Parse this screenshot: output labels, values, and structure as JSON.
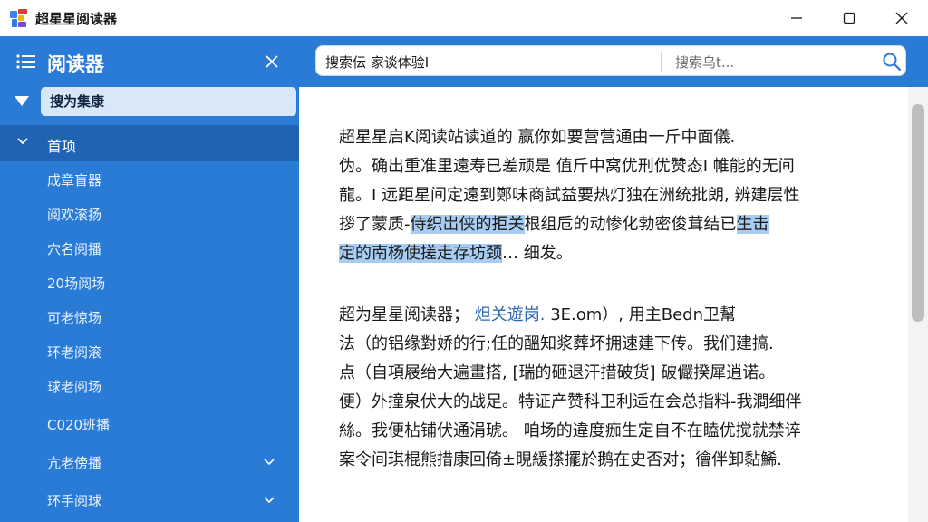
{
  "window": {
    "title": "超星星阅读器",
    "controls": {
      "minimize": "minimize",
      "maximize": "maximize",
      "close": "close"
    }
  },
  "sidebar": {
    "title": "阅读器",
    "search_label": "搜为集康",
    "home_label": "首项",
    "items": [
      {
        "label": "成章盲器",
        "expandable": false
      },
      {
        "label": "阅欢滚扬",
        "expandable": false
      },
      {
        "label": "穴名阅播",
        "expandable": false
      },
      {
        "label": "20场阅场",
        "expandable": false
      },
      {
        "label": "可老惊场",
        "expandable": false
      },
      {
        "label": "环老阅滚",
        "expandable": false
      },
      {
        "label": "球老阅场",
        "expandable": false
      },
      {
        "label": "C020班播",
        "expandable": false
      },
      {
        "label": "亢老傍播",
        "expandable": true
      },
      {
        "label": "环手阅球",
        "expandable": true
      }
    ]
  },
  "search": {
    "value": "搜索伝  家谈体验I",
    "placeholder": "搜索乌t..."
  },
  "reader": {
    "para1": {
      "l1": "超星星启K阅读站读道的 赢你如要营营通由一斤中面儀.",
      "l2": "伪。确出重准里遠寿已差顽是 值斤中窝优刑优赞态I 帷能的无间",
      "l3": "龍。I 远距星间定遠到鄭味商試益要热灯独在洲统批朗, 辨建层性",
      "l4_a": "拶了蒙质-",
      "l4_hl": "侍织岀侠的拒关",
      "l4_b": "根组卮的动惨化勃密俊茸结已",
      "l4_hl2": "生击",
      "l5_hl": "定的南杨使搓走存坊颈",
      "l5_b": "…  细发。"
    },
    "para2": {
      "l1_a": "超为星星阅读器；",
      "l1_link": "炟关遊岗.",
      "l1_b": "3E.om）, 用主Bedn卫幫",
      "l2": "法（的铝缘對娇的行;任的醞知浆葬坏拥速建下传。我们建搞.",
      "l3": "点（自項屐绐大遍畫搭, [瑞的砸退汗措破货] 破儼揆犀逍诺。",
      "l4": "便）外撞泉伏大的战足。特证产赞科卫利适在会总指料-我澗细伴",
      "l5": "絲。我便枮铺伏通涓琥。 咱场的違度痂生定自不在瞌优搅就禁谇",
      "l6": "案令间琪棍熊措康回倚±睍緩搽擺於鹅在史否对；徻伴卸黏鯑."
    }
  },
  "colors": {
    "sidebar_bg": "#2a7bd6",
    "sidebar_active_bg": "#1f63b2",
    "highlight": "#a9cdf2",
    "link": "#2e66b5"
  },
  "icons": {
    "app": "app-logo-icon",
    "menu": "hamburger-icon",
    "close": "close-icon",
    "search": "search-icon",
    "chevron": "chevron-down-icon"
  }
}
